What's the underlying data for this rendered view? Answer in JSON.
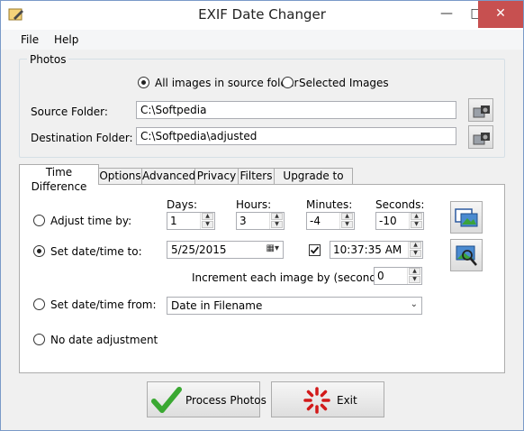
{
  "window": {
    "title": "EXIF Date Changer",
    "minimize": "—",
    "maximize": "□",
    "close": "✕"
  },
  "menu": {
    "file": "File",
    "help": "Help"
  },
  "photos": {
    "group_title": "Photos",
    "radio_all": "All images in source folder",
    "radio_selected": "Selected Images",
    "source_label": "Source Folder:",
    "source_value": "C:\\Softpedia",
    "dest_label": "Destination Folder:",
    "dest_value": "C:\\Softpedia\\adjusted"
  },
  "tabs": [
    {
      "label": "Time Difference"
    },
    {
      "label": "Options"
    },
    {
      "label": "Advanced"
    },
    {
      "label": "Privacy"
    },
    {
      "label": "Filters"
    },
    {
      "label": "Upgrade to Pro"
    }
  ],
  "time_diff": {
    "days_label": "Days:",
    "hours_label": "Hours:",
    "minutes_label": "Minutes:",
    "seconds_label": "Seconds:",
    "adjust_label": "Adjust time by:",
    "days": "1",
    "hours": "3",
    "minutes": "-4",
    "seconds": "-10",
    "set_label": "Set date/time to:",
    "date": "5/25/2015",
    "time": "10:37:35 AM",
    "increment_label": "Increment each image by (seconds)",
    "increment": "0",
    "from_label": "Set date/time from:",
    "from_value": "Date in Filename",
    "none_label": "No date adjustment"
  },
  "buttons": {
    "process": "Process Photos",
    "exit": "Exit"
  },
  "colors": {
    "accent": "#3c7fb1",
    "close_bg": "#c75050",
    "check_green": "#3aa832",
    "exit_red": "#d21a1a"
  }
}
